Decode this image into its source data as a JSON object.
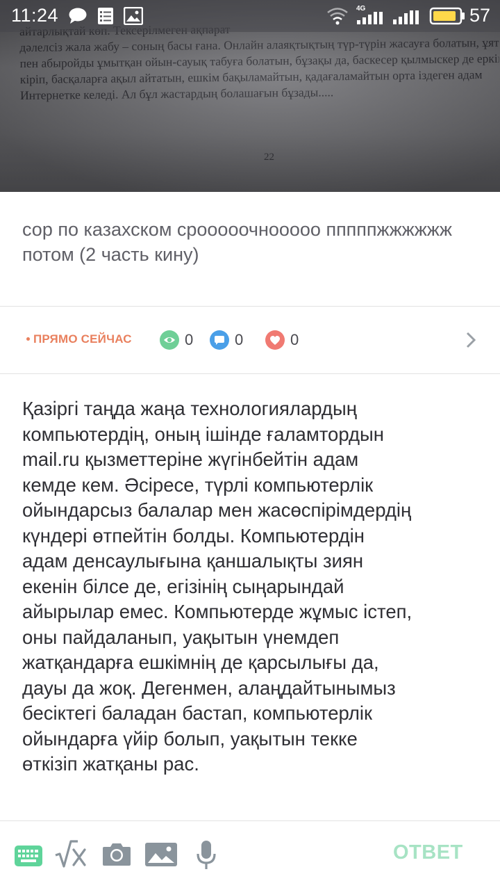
{
  "status_bar": {
    "time": "11:24",
    "network": "4G",
    "battery": "57",
    "left_icons": [
      "chat-bubble-icon",
      "checklist-icon",
      "image-icon"
    ],
    "right_icons": [
      "wifi-icon",
      "signal-icon",
      "signal-icon",
      "battery-icon"
    ]
  },
  "photo": {
    "lines": [
      "айтарлықтай көп.  Тексерілмеген ақпарат  ",
      "дәлелсіз жала жабу – соның басы ғана. Онлайн алаяқтықтың түр-түрін жасауға болатын, ұят",
      "пен абыройды ұмытқан ойын-сауық табуға болатын, бұзақы да, баскесер қылмыскер де еркін",
      "кіріп, басқаларға ақыл айтатын, ешкім бақыламайтын, қадағаламайтын орта іздеген адам",
      "Интернетке келеді.  Ал бұл жастардың болашағын бұзады....."
    ],
    "page_number": "22"
  },
  "question": {
    "title": "сор по казахском срооооочнооооо пппппжжжжжж потом (2 часть кину)"
  },
  "info_bar": {
    "status_label": "ПРЯМО СЕЙЧАС",
    "views": "0",
    "comments": "0",
    "likes": "0",
    "colors": {
      "status": "#e9805e",
      "views": "#6fcf97",
      "comments": "#4a9fe8",
      "likes": "#f07a72"
    }
  },
  "answer": {
    "lines": [
      "Қазіргі таңда жаңа технологиялардың",
      "компьютердің, оның ішінде ғаламтордын",
      "mail.ru қызметтеріне жүгінбейтін адам",
      "кемде кем. Әсіресе, түрлі компьютерлік",
      "ойындарсыз балалар мен жасөспірімдердің",
      "күндері өтпейтін болды. Компьютердін",
      "адам денсаулығына қаншалықты зиян",
      "екенін білсе де, егізінің сыңарындай",
      "айырылар емес. Компьютерде жұмыс істеп,",
      "оны пайдаланып, уақытын үнемдеп",
      "жатқандарға ешкімнің де қарсылығы да,",
      "дауы да жоқ. Дегенмен, алаңдайтынымыз",
      "бесіктегі баладан бастап, компьютерлік",
      "ойындарға үйір болып, уақытын текке",
      "өткізіп жатқаны рас."
    ]
  },
  "toolbar": {
    "answer_label": "ОТВЕТ",
    "tools": [
      "keyboard-icon",
      "math-formula-icon",
      "camera-icon",
      "gallery-icon",
      "microphone-icon"
    ],
    "colors": {
      "icons": "#8a949c",
      "keyboard": "#5fd49a",
      "answer": "#a7e3c4"
    }
  }
}
